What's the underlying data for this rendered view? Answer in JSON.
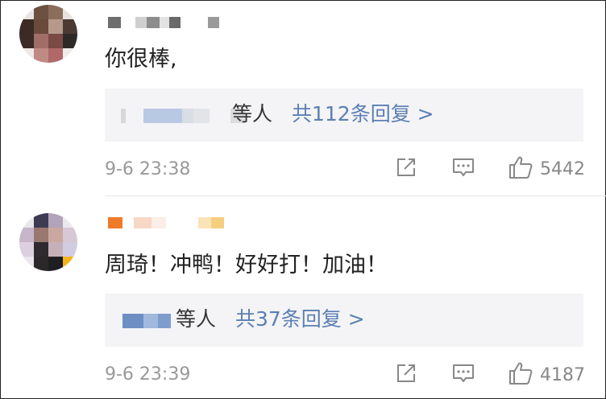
{
  "comments": [
    {
      "text": "你很棒,",
      "reply_others": "等人",
      "reply_link": "共112条回复 >",
      "time": "9-6 23:38",
      "likes": "5442",
      "icons": [
        "share-icon",
        "comment-icon",
        "thumbs-up-icon"
      ]
    },
    {
      "text": "周琦！冲鸭！好好打！加油！",
      "reply_others": "等人",
      "reply_link": "共37条回复 >",
      "time": "9-6 23:39",
      "likes": "4187",
      "icons": [
        "share-icon",
        "comment-icon",
        "thumbs-up-icon"
      ]
    }
  ],
  "colors": {
    "link": "#5b7fb3",
    "meta": "#999999",
    "reply_bg": "#f4f4f6",
    "icon": "#888888"
  }
}
